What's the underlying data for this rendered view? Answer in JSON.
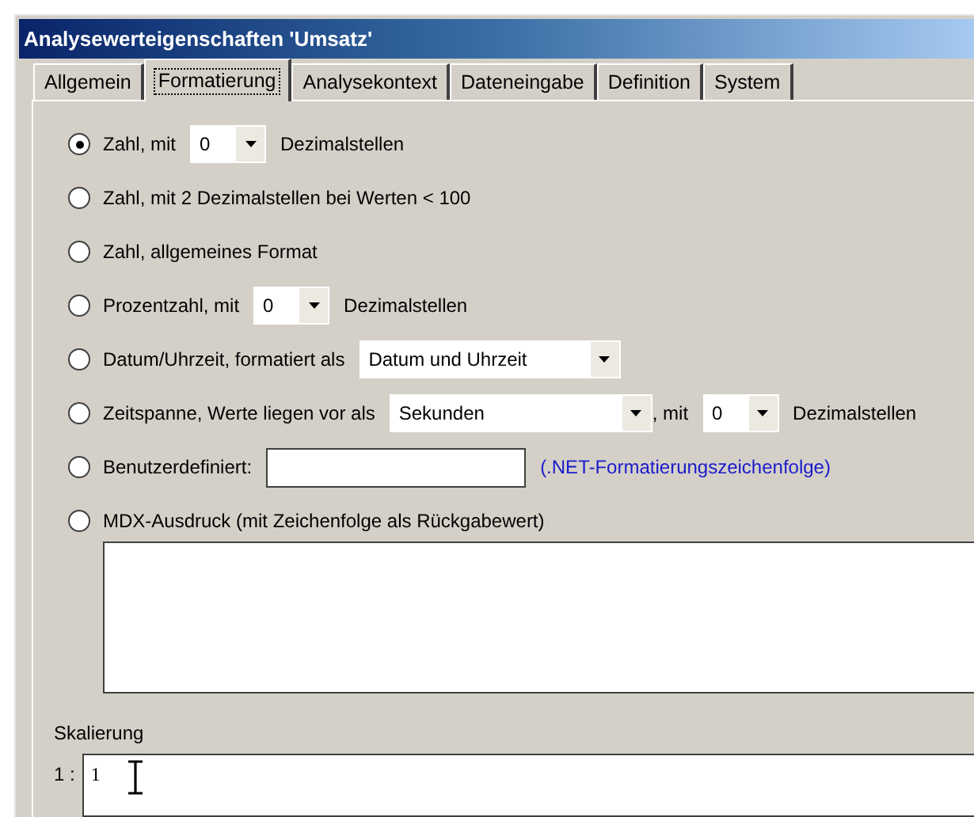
{
  "window": {
    "title": "Analysewerteigenschaften 'Umsatz'"
  },
  "tabs": [
    {
      "label": "Allgemein",
      "selected": false
    },
    {
      "label": "Formatierung",
      "selected": true
    },
    {
      "label": "Analysekontext",
      "selected": false
    },
    {
      "label": "Dateneingabe",
      "selected": false
    },
    {
      "label": "Definition",
      "selected": false
    },
    {
      "label": "System",
      "selected": false
    }
  ],
  "format_options": [
    {
      "selected": true,
      "parts": [
        {
          "kind": "text",
          "text": "Zahl, mit"
        },
        {
          "kind": "dropdown",
          "value": "0"
        },
        {
          "kind": "text",
          "text": "Dezimalstellen"
        }
      ]
    },
    {
      "selected": false,
      "parts": [
        {
          "kind": "text",
          "text": "Zahl, mit 2 Dezimalstellen bei Werten  < 100"
        }
      ]
    },
    {
      "selected": false,
      "parts": [
        {
          "kind": "text",
          "text": "Zahl, allgemeines Format"
        }
      ]
    },
    {
      "selected": false,
      "parts": [
        {
          "kind": "text",
          "text": "Prozentzahl, mit"
        },
        {
          "kind": "dropdown",
          "value": "0"
        },
        {
          "kind": "text",
          "text": "Dezimalstellen"
        }
      ]
    },
    {
      "selected": false,
      "parts": [
        {
          "kind": "text",
          "text": "Datum/Uhrzeit, formatiert als"
        },
        {
          "kind": "dropdown",
          "value": "Datum und Uhrzeit"
        }
      ]
    },
    {
      "selected": false,
      "parts": [
        {
          "kind": "text",
          "text": "Zeitspanne, Werte liegen vor als"
        },
        {
          "kind": "dropdown",
          "value": "Sekunden"
        },
        {
          "kind": "text",
          "text": ", mit"
        },
        {
          "kind": "dropdown",
          "value": "0"
        },
        {
          "kind": "text",
          "text": "Dezimalstellen"
        }
      ]
    },
    {
      "selected": false,
      "parts": [
        {
          "kind": "text",
          "text": "Benutzerdefiniert:"
        },
        {
          "kind": "input"
        },
        {
          "kind": "link",
          "text": "(.NET-Formatierungszeichenfolge)"
        }
      ]
    },
    {
      "selected": false,
      "parts": [
        {
          "kind": "text",
          "text": "MDX-Ausdruck (mit Zeichenfolge als Rückgabewert)"
        }
      ],
      "has_textarea": true
    }
  ],
  "scaling": {
    "label": "Skalierung",
    "prefix": "1 :",
    "value": "1"
  }
}
